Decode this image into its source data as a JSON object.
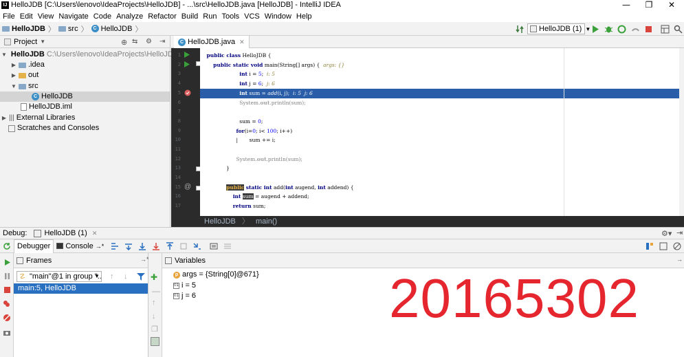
{
  "window": {
    "title": "HelloJDB [C:\\Users\\lenovo\\IdeaProjects\\HelloJDB] - ...\\src\\HelloJDB.java [HelloJDB] - IntelliJ IDEA",
    "min": "—",
    "max": "❐",
    "close": "✕"
  },
  "menu": [
    "File",
    "Edit",
    "View",
    "Navigate",
    "Code",
    "Analyze",
    "Refactor",
    "Build",
    "Run",
    "Tools",
    "VCS",
    "Window",
    "Help"
  ],
  "breadcrumb": {
    "project": "HelloJDB",
    "folder": "src",
    "file": "HelloJDB"
  },
  "run_config": "HelloJDB (1)",
  "project_panel": {
    "title": "Project",
    "root_name": "HelloJDB",
    "root_path": "C:\\Users\\lenovo\\IdeaProjects\\HelloJDB",
    "items": [
      ".idea",
      "out",
      "src",
      "HelloJDB",
      "HelloJDB.iml",
      "External Libraries",
      "Scratches and Consoles"
    ]
  },
  "editor": {
    "tab": "HelloJDB.java",
    "line_numbers": [
      "1",
      "2",
      "3",
      "4",
      "5",
      "6",
      "7",
      "8",
      "9",
      "10",
      "11",
      "12",
      "13",
      "14",
      "15",
      "16",
      "17"
    ],
    "crumbs": {
      "cls": "HelloJDB",
      "method": "main()"
    }
  },
  "debug": {
    "label": "Debug:",
    "session": "HelloJDB (1)",
    "tabs": {
      "debugger": "Debugger",
      "console": "Console"
    },
    "frames_title": "Frames",
    "thread": "\"main\"@1 in group \"...",
    "selected_frame": "main:5, HelloJDB",
    "variables_title": "Variables",
    "variables": [
      {
        "name": "args",
        "value": "= {String[0]@671}"
      },
      {
        "name": "i",
        "value": "= 5"
      },
      {
        "name": "j",
        "value": "= 6"
      }
    ]
  },
  "watermark": "20165302",
  "colors": {
    "selection": "#2a5ea8",
    "frame_selection": "#2a70c0",
    "watermark": "#e6262e",
    "gutter": "#2b2b2b"
  }
}
